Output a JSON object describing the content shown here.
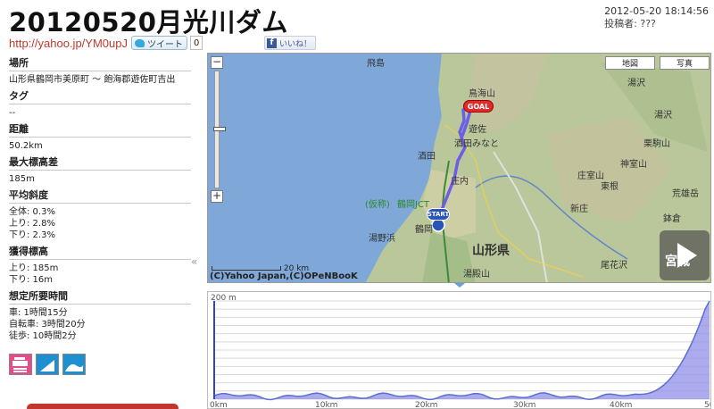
{
  "page": {
    "title": "20120520月光川ダム",
    "date": "2012-05-20 18:14:56",
    "author_label": "投稿者: ???",
    "short_url": "http://yahoo.jp/YM0upJ",
    "tweet_label": "ツイート",
    "tweet_count": "0",
    "like_label": "いいね！"
  },
  "sidebar": {
    "location_label": "場所",
    "location_value": "山形県鶴岡市美原町 〜 飽海郡遊佐町吉出",
    "tag_label": "タグ",
    "tag_value": "--",
    "distance_label": "距離",
    "distance_value": "50.2km",
    "max_elev_diff_label": "最大標高差",
    "max_elev_diff_value": "185m",
    "avg_grade_label": "平均斜度",
    "avg_grade_total": "全体: 0.3%",
    "avg_grade_up": "上り: 2.8%",
    "avg_grade_down": "下り: 2.3%",
    "gain_label": "獲得標高",
    "gain_up": "上り: 185m",
    "gain_down": "下り: 16m",
    "time_label": "想定所要時間",
    "time_car": "車: 1時間15分",
    "time_bike": "自転車: 3時間20分",
    "time_walk": "徒歩: 10時間2分",
    "collapse_icon": "«"
  },
  "map": {
    "zoom_in": "+",
    "zoom_out": "−",
    "type_map": "地図",
    "type_photo": "写真",
    "scale_label": "20 km",
    "copyright": "(C)Yahoo Japan,(C)OPeNBooK",
    "goal_label": "GOAL",
    "start_label": "START",
    "places": {
      "tobishima": "飛島",
      "chokai": "鳥海山",
      "yuza": "遊佐",
      "sakata_minato": "酒田みなと",
      "sakata": "酒田",
      "shonai": "庄内",
      "kari": "(仮称)",
      "tsuruoka_jct": "鶴岡JCT",
      "tsuruoka": "鶴岡",
      "yunohama": "湯野浜",
      "yudonosan": "湯殿山",
      "yamagata": "山形県",
      "shinjo": "新庄",
      "ohanazawa": "尾花沢",
      "higashine": "東根",
      "kurikoma": "栗駒山",
      "kamuro": "神室山",
      "shomuro": "庄室山",
      "miyagi": "宮城",
      "yuzawa": "湯沢",
      "arao": "荒雄岳",
      "hachikura": "鉢倉",
      "yuzawa2": "湯沢"
    }
  },
  "elevation": {
    "y_max_label": "200 m",
    "x_labels": [
      "0km",
      "10km",
      "20km",
      "30km",
      "40km",
      "50"
    ],
    "colors": {
      "line": "#5b6fd0",
      "fill": "#8f8fe8",
      "grid": "#d8d8d8"
    }
  }
}
